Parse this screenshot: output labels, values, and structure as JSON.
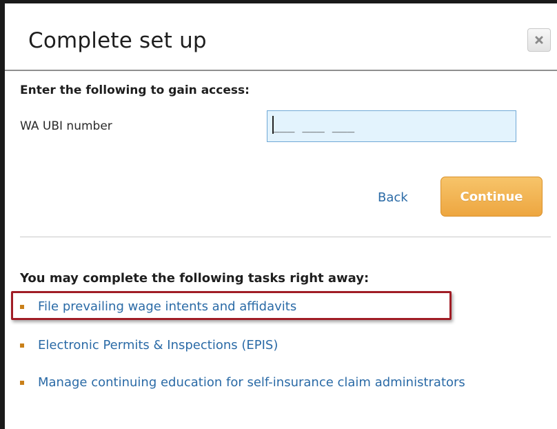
{
  "dialog": {
    "title": "Complete set up",
    "close_icon": "close-icon"
  },
  "access_section": {
    "heading": "Enter the following to gain access:",
    "field_label": "WA UBI number",
    "input_value": "",
    "input_mask": "___ ___ ___"
  },
  "actions": {
    "back_label": "Back",
    "continue_label": "Continue"
  },
  "tasks": {
    "heading": "You may complete the following tasks right away:",
    "items": [
      {
        "label": "File prevailing wage intents and affidavits"
      },
      {
        "label": "Electronic Permits & Inspections (EPIS)"
      },
      {
        "label": "Manage continuing education for self-insurance claim administrators"
      }
    ]
  },
  "colors": {
    "link": "#2a6aa6",
    "accent": "#eda640",
    "bullet": "#c9801a",
    "highlight": "#a01c25",
    "input_bg": "#e3f3fd"
  }
}
